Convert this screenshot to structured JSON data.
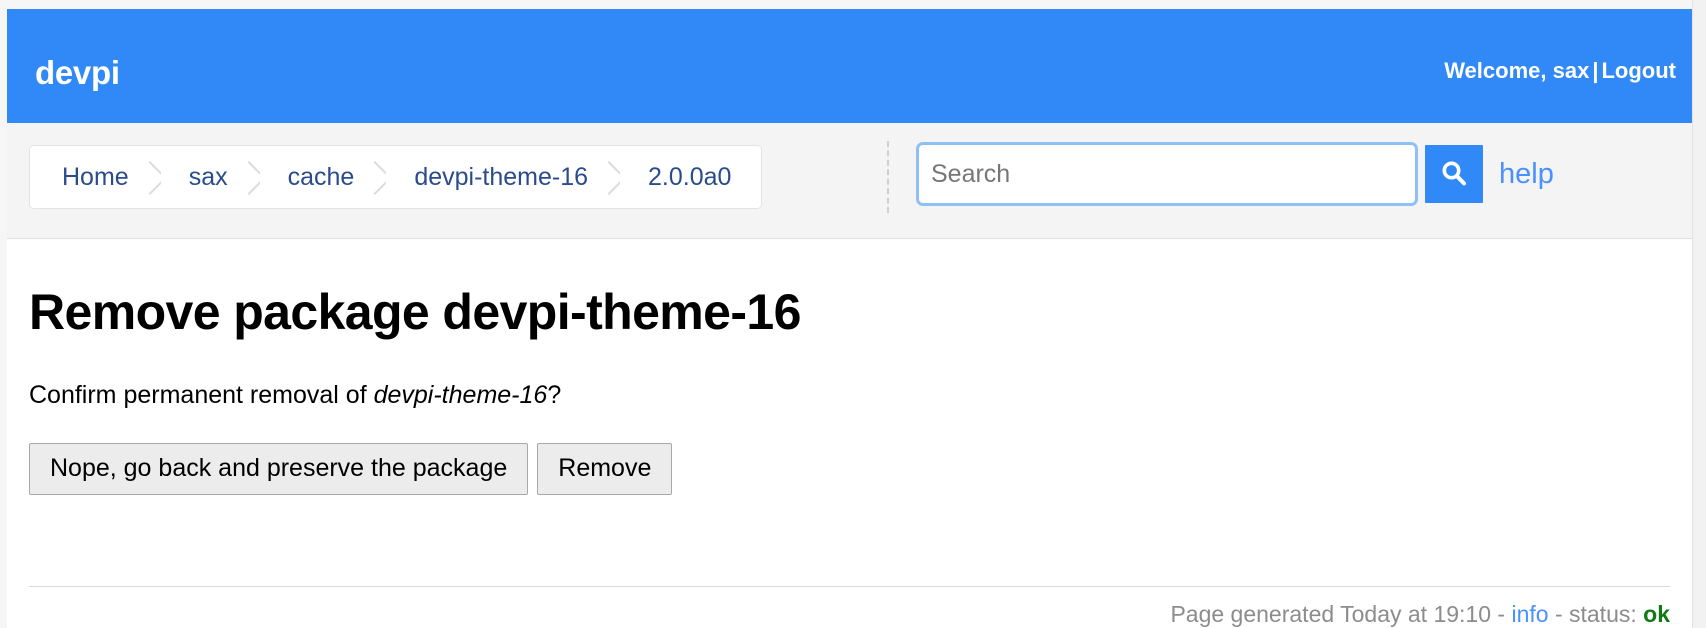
{
  "header": {
    "brand": "devpi",
    "welcome": "Welcome, sax",
    "separator": "|",
    "logout": "Logout"
  },
  "nav": {
    "breadcrumb": [
      {
        "label": "Home"
      },
      {
        "label": "sax"
      },
      {
        "label": "cache"
      },
      {
        "label": "devpi-theme-16"
      },
      {
        "label": "2.0.0a0"
      }
    ],
    "search": {
      "value": "",
      "placeholder": "Search",
      "button_icon": "search-icon"
    },
    "help_label": "help"
  },
  "main": {
    "title": "Remove package devpi-theme-16",
    "confirm_prefix": "Confirm permanent removal of ",
    "confirm_package": "devpi-theme-16",
    "confirm_suffix": "?",
    "cancel_label": "Nope, go back and preserve the package",
    "remove_label": "Remove"
  },
  "footer": {
    "generated": "Page generated Today at 19:10 - ",
    "info_label": "info",
    "status_prefix": " - status: ",
    "status_value": "ok"
  },
  "colors": {
    "brand_blue": "#3189f7",
    "link_blue": "#4a90ff",
    "crumb_blue": "#2a4b8d",
    "status_green": "#127a12",
    "navbar_bg": "#f4f4f4",
    "button_bg": "#ececec"
  }
}
